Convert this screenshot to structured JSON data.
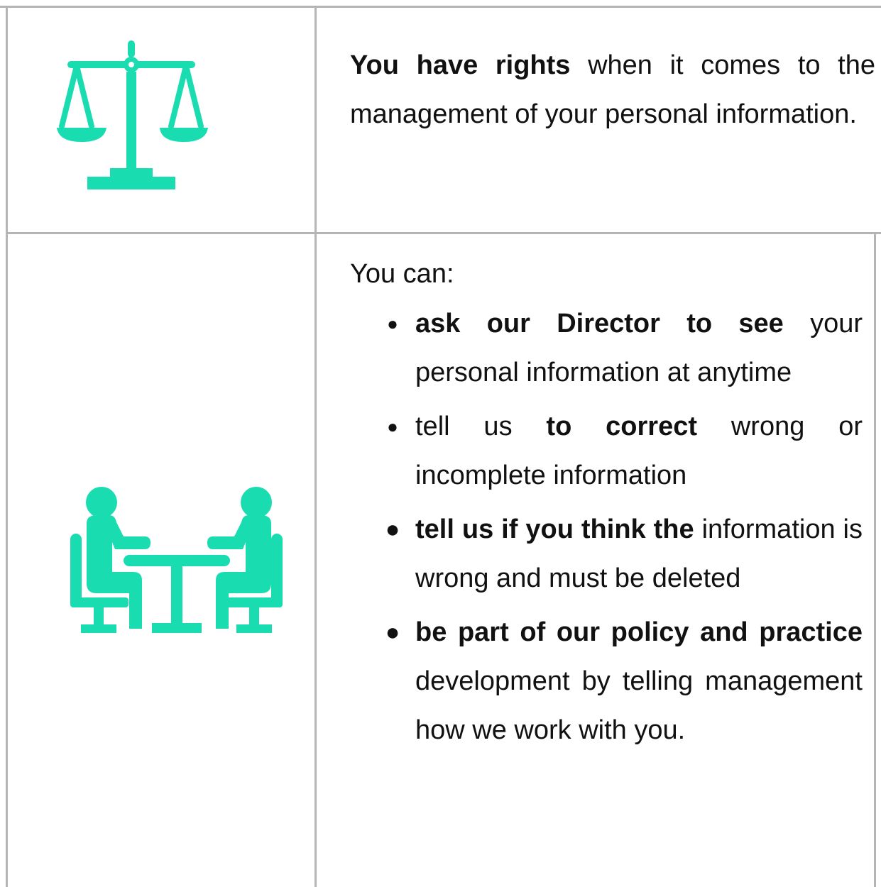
{
  "rows": [
    {
      "icon": "scales-of-justice-icon",
      "intro_bold": "You have rights",
      "intro_rest": " when it comes to the management of your personal information."
    },
    {
      "icon": "meeting-people-table-icon",
      "lead": "You can:",
      "items": [
        {
          "bold": "ask our Director to see",
          "rest": " your personal information at anytime"
        },
        {
          "pre": "tell us ",
          "bold": "to correct",
          "rest": " wrong or incomplete information"
        },
        {
          "bold": "tell us if you think the",
          "rest": " information is wrong and must be deleted"
        },
        {
          "bold": "be part of our policy and practice",
          "rest": " development by telling management how we work with you."
        }
      ]
    }
  ],
  "colors": {
    "icon": "#19dcb0",
    "border": "#b5b5b5",
    "text": "#111111"
  }
}
